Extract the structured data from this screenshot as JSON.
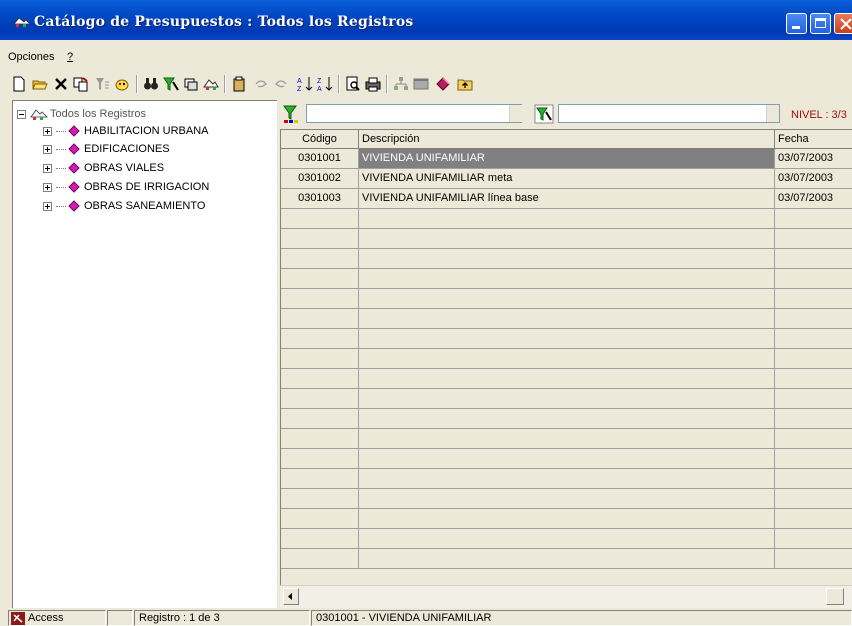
{
  "window": {
    "title": "Catálogo de Presupuestos  :  Todos los Registros",
    "title_color": "#ffffff",
    "titlebar_color": "#0047c4"
  },
  "menubar": {
    "items": [
      {
        "label": "Opciones"
      },
      {
        "label": "?"
      }
    ]
  },
  "toolbar": {
    "buttons": [
      {
        "icon": "new-document-icon"
      },
      {
        "icon": "open-folder-icon"
      },
      {
        "icon": "delete-x-icon"
      },
      {
        "icon": "copy-icon"
      },
      {
        "icon": "filter-tree-icon"
      },
      {
        "icon": "paint-icon"
      },
      {
        "icon": "binoculars-icon"
      },
      {
        "icon": "filter-funnel-icon"
      },
      {
        "icon": "group-icon"
      },
      {
        "icon": "catalog-icon"
      },
      {
        "icon": "paste-icon"
      },
      {
        "icon": "undo-icon"
      },
      {
        "icon": "redo-icon"
      },
      {
        "icon": "sort-ascending-icon"
      },
      {
        "icon": "sort-descending-icon"
      },
      {
        "icon": "print-preview-icon"
      },
      {
        "icon": "print-icon"
      },
      {
        "icon": "hierarchy-icon"
      },
      {
        "icon": "window-icon"
      },
      {
        "icon": "book-icon"
      },
      {
        "icon": "folder-up-icon"
      }
    ]
  },
  "tree": {
    "root": "Todos los Registros",
    "nodes": [
      {
        "label": "HABILITACION URBANA"
      },
      {
        "label": "EDIFICACIONES"
      },
      {
        "label": "OBRAS VIALES"
      },
      {
        "label": "OBRAS DE IRRIGACION"
      },
      {
        "label": "OBRAS SANEAMIENTO"
      }
    ],
    "node_color": "#d11fb0"
  },
  "filter": {
    "value1": "",
    "value2": "",
    "nivel": "NIVEL : 3/3"
  },
  "grid": {
    "columns": [
      "Código",
      "Descripción",
      "Fecha"
    ],
    "rows": [
      {
        "codigo": "0301001",
        "descripcion": "VIVIENDA UNIFAMILIAR",
        "fecha": "03/07/2003",
        "selected": true
      },
      {
        "codigo": "0301002",
        "descripcion": "VIVIENDA UNIFAMILIAR meta",
        "fecha": "03/07/2003",
        "selected": false
      },
      {
        "codigo": "0301003",
        "descripcion": "VIVIENDA UNIFAMILIAR línea base",
        "fecha": "03/07/2003",
        "selected": false
      }
    ],
    "empty_rows": 18,
    "selected_color": "#808080"
  },
  "statusbar": {
    "db": "Access",
    "empty": "",
    "registro": "Registro :  1 de  3",
    "current": "0301001 - VIVIENDA UNIFAMILIAR"
  }
}
